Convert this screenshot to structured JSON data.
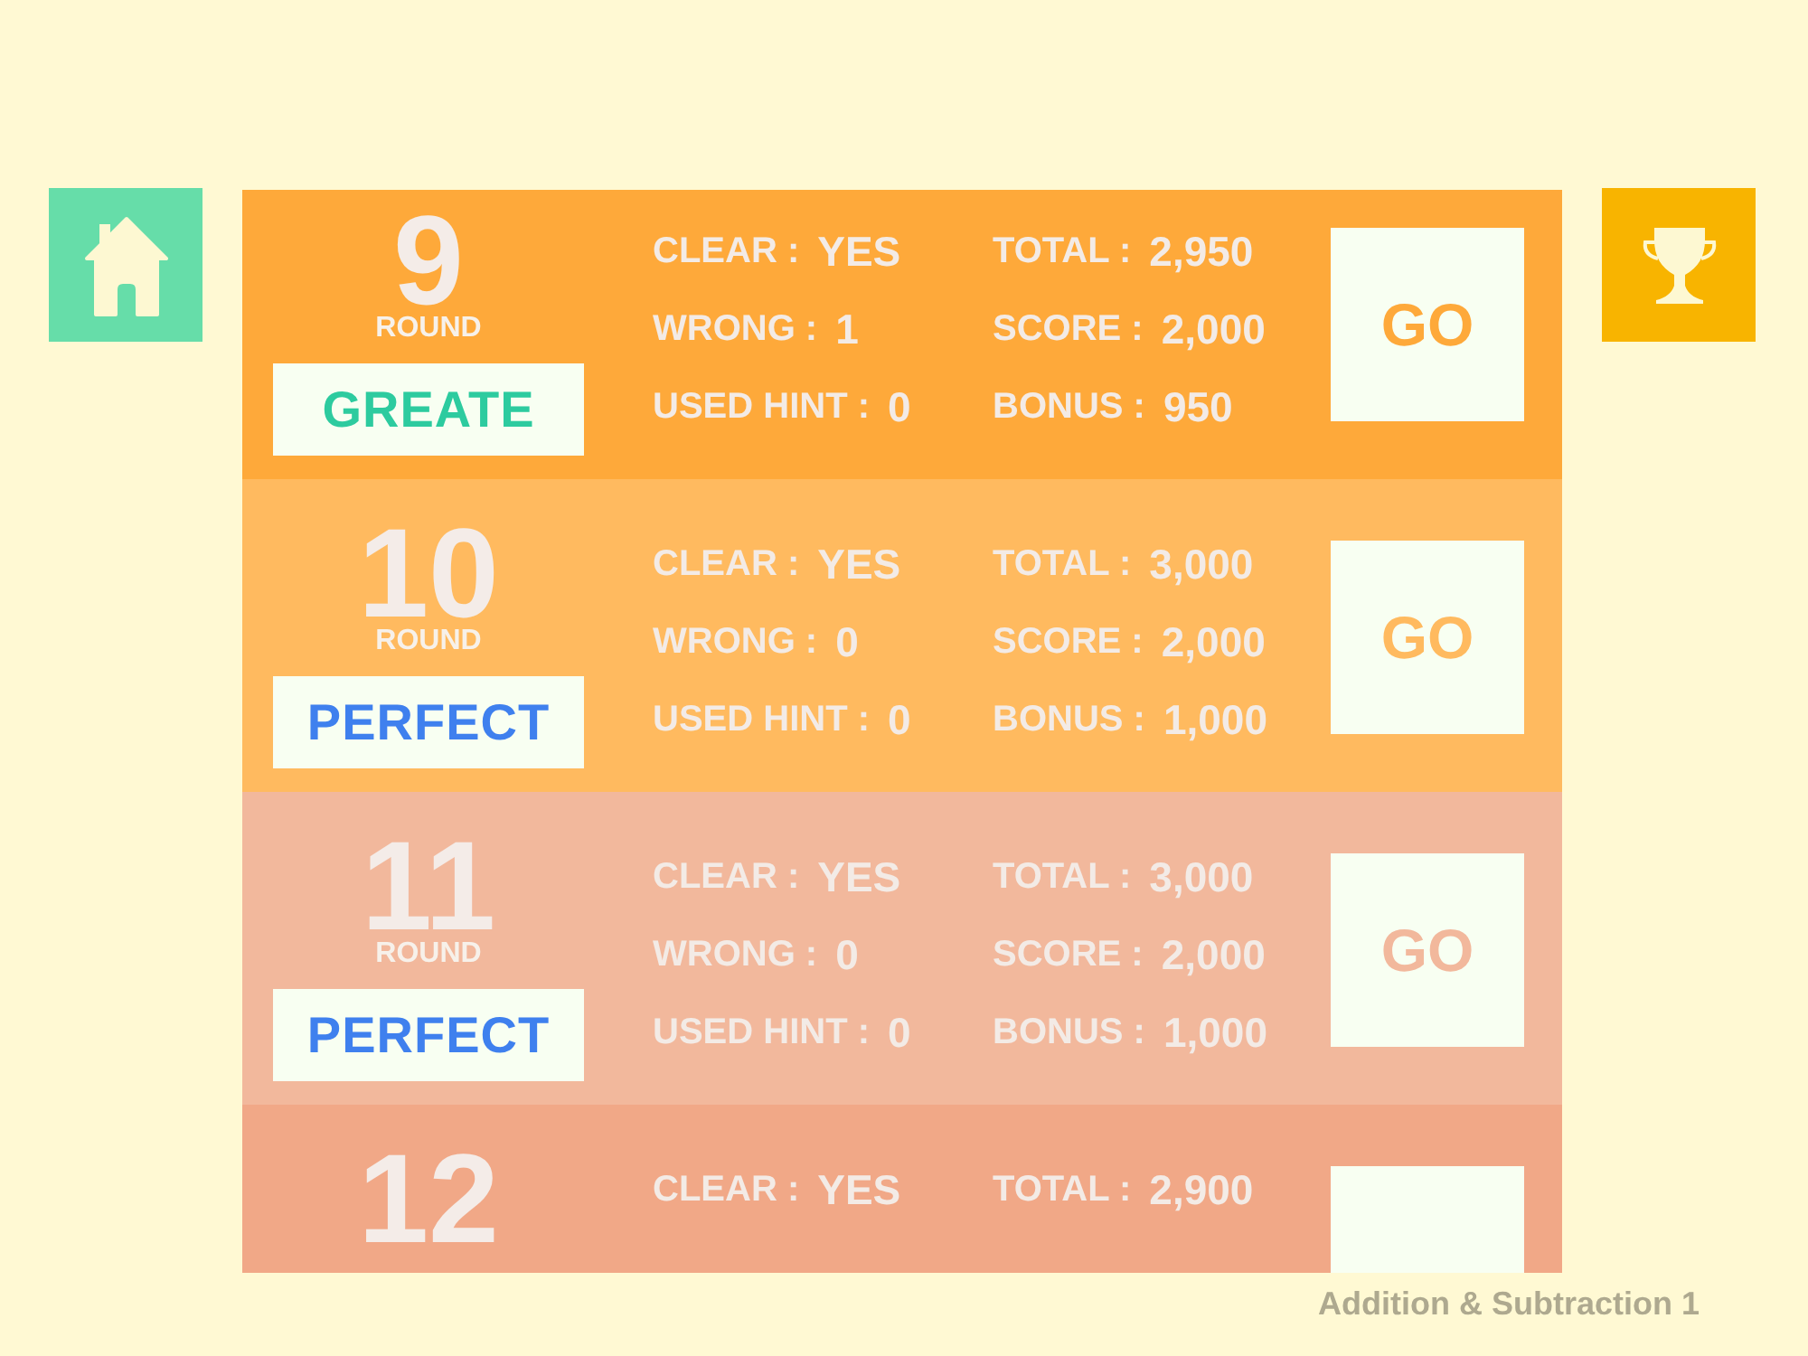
{
  "rows": [
    {
      "color": "#fea93a",
      "round": "9",
      "round_label": "ROUND",
      "grade": {
        "text": "GREATE",
        "color": "#2dcb9f"
      },
      "stats_left": [
        {
          "label": "CLEAR :",
          "value": "YES"
        },
        {
          "label": "WRONG :",
          "value": "1"
        },
        {
          "label": "USED HINT :",
          "value": "0"
        }
      ],
      "stats_right": [
        {
          "label": "TOTAL :",
          "value": "2,950"
        },
        {
          "label": "SCORE :",
          "value": "2,000"
        },
        {
          "label": "BONUS :",
          "value": "950"
        }
      ],
      "go_label": "GO"
    },
    {
      "color": "#ffba5f",
      "round": "10",
      "round_label": "ROUND",
      "grade": {
        "text": "PERFECT",
        "color": "#3f80ee"
      },
      "stats_left": [
        {
          "label": "CLEAR :",
          "value": "YES"
        },
        {
          "label": "WRONG :",
          "value": "0"
        },
        {
          "label": "USED HINT :",
          "value": "0"
        }
      ],
      "stats_right": [
        {
          "label": "TOTAL :",
          "value": "3,000"
        },
        {
          "label": "SCORE :",
          "value": "2,000"
        },
        {
          "label": "BONUS :",
          "value": "1,000"
        }
      ],
      "go_label": "GO"
    },
    {
      "color": "#f2b89c",
      "round": "11",
      "round_label": "ROUND",
      "grade": {
        "text": "PERFECT",
        "color": "#3f80ee"
      },
      "stats_left": [
        {
          "label": "CLEAR :",
          "value": "YES"
        },
        {
          "label": "WRONG :",
          "value": "0"
        },
        {
          "label": "USED HINT :",
          "value": "0"
        }
      ],
      "stats_right": [
        {
          "label": "TOTAL :",
          "value": "3,000"
        },
        {
          "label": "SCORE :",
          "value": "2,000"
        },
        {
          "label": "BONUS :",
          "value": "1,000"
        }
      ],
      "go_label": "GO"
    },
    {
      "color": "#f1a887",
      "round": "12",
      "stats_left": [
        {
          "label": "CLEAR :",
          "value": "YES"
        }
      ],
      "stats_right": [
        {
          "label": "TOTAL :",
          "value": "2,900"
        }
      ]
    }
  ],
  "footer": "Addition & Subtraction 1"
}
